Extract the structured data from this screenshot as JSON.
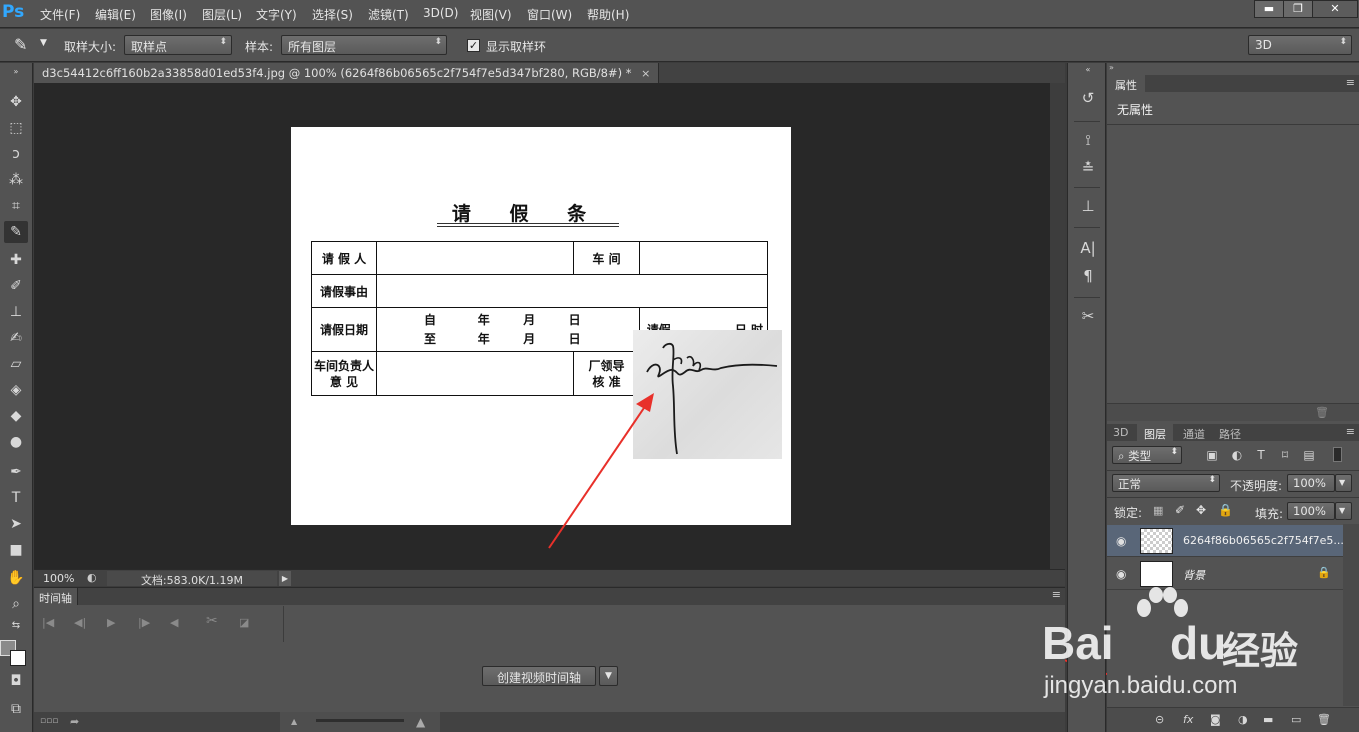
{
  "app": {
    "logo": "Ps",
    "menus": [
      "文件(F)",
      "编辑(E)",
      "图像(I)",
      "图层(L)",
      "文字(Y)",
      "选择(S)",
      "滤镜(T)",
      "3D(D)",
      "视图(V)",
      "窗口(W)",
      "帮助(H)"
    ],
    "window_buttons": {
      "minimize": "▬",
      "restore": "❐",
      "close": "✕"
    }
  },
  "options": {
    "sample_size_label": "取样大小:",
    "sample_size_value": "取样点",
    "sample_label": "样本:",
    "sample_value": "所有图层",
    "show_ring_label": "显示取样环",
    "show_ring_checked": true,
    "workspace_value": "3D"
  },
  "document": {
    "tab_title": "d3c54412c6ff160b2a33858d01ed53f4.jpg @ 100% (6264f86b06565c2f754f7e5d347bf280, RGB/8#) *",
    "tab_close": "×",
    "form": {
      "title": "请 假 条",
      "applicant_label": "请 假 人",
      "workshop_label": "车 间",
      "reason_label": "请假事由",
      "date_label": "请假日期",
      "date_lines": "自          年        月        日\n至          年        月        日",
      "duration_label": "请假",
      "duration_units": "日        时",
      "workshop_head_label": "车间负责人\n意 见",
      "factory_lead_label": "厂领导\n核 准"
    }
  },
  "status": {
    "zoom": "100%",
    "doc_info": "文档:583.0K/1.19M"
  },
  "timeline": {
    "tab_label": "时间轴",
    "create_button": "创建视频时间轴"
  },
  "properties": {
    "tab_label": "属性",
    "empty_text": "无属性"
  },
  "layers": {
    "tabs": [
      "3D",
      "图层",
      "通道",
      "路径"
    ],
    "active_tab": "图层",
    "filter_type": "类型",
    "blend_mode": "正常",
    "opacity_label": "不透明度:",
    "opacity_value": "100%",
    "lock_label": "锁定:",
    "fill_label": "填充:",
    "fill_value": "100%",
    "items": [
      {
        "name": "6264f86b06565c2f754f7e5...",
        "selected": true,
        "locked": false
      },
      {
        "name": "背景",
        "selected": false,
        "locked": true
      }
    ]
  },
  "watermark": {
    "brand": "Bai",
    "brand_suffix": "du",
    "product": "经验",
    "url": "jingyan.baidu.com"
  },
  "colors": {
    "accent_arrow": "#e8302a",
    "selected_layer": "#596678",
    "ps_logo": "#31a8ff"
  }
}
